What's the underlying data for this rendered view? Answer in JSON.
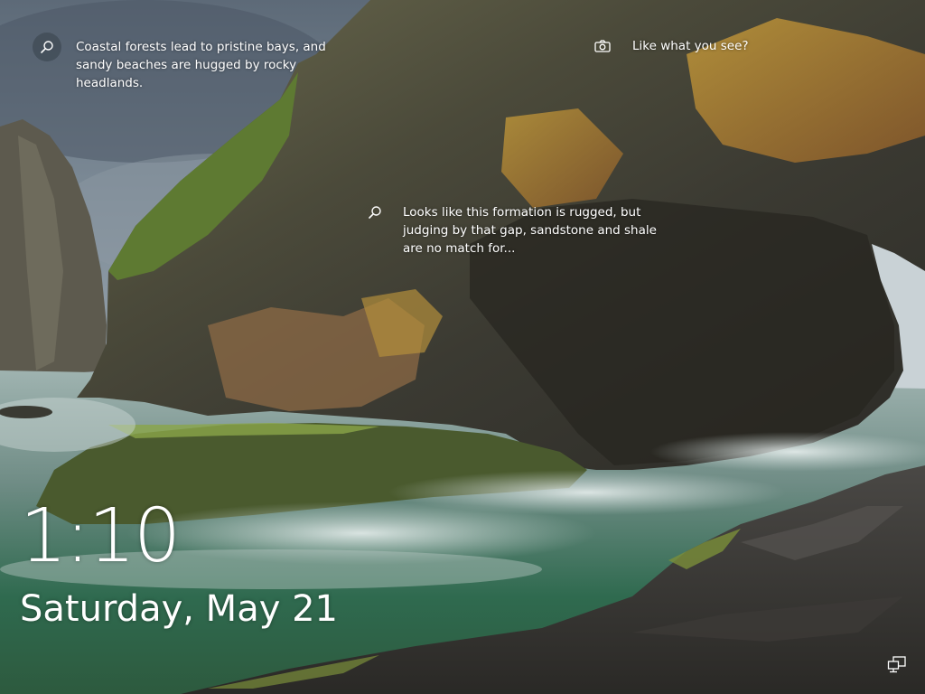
{
  "lockscreen": {
    "spotlight": {
      "fact_1": "Coastal forests lead to pristine bays, and sandy beaches are hugged by rocky headlands.",
      "like_prompt": "Like what you see?",
      "fact_2": "Looks like this formation is rugged, but judging by that gap, sandstone and shale are no match for..."
    },
    "clock": {
      "time": "1:10",
      "date": "Saturday, May 21"
    },
    "icons": {
      "spotlight_search": "search-icon",
      "camera": "camera-icon",
      "network": "network-icon"
    }
  }
}
